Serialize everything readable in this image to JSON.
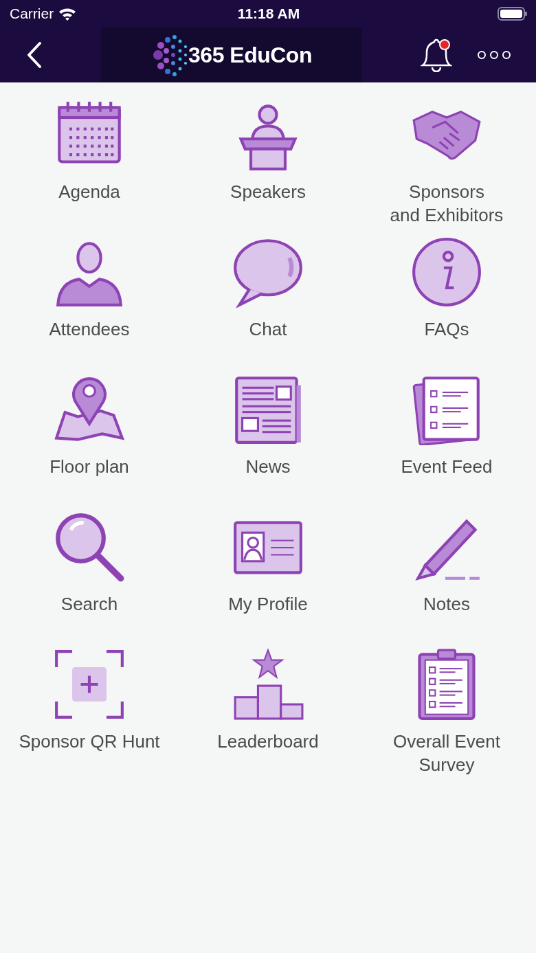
{
  "status_bar": {
    "carrier": "Carrier",
    "time": "11:18 AM"
  },
  "nav_bar": {
    "logo_text": "365 EduCon",
    "notification": true
  },
  "tiles": [
    {
      "label": "Agenda"
    },
    {
      "label": "Speakers"
    },
    {
      "label": "Sponsors\nand Exhibitors"
    },
    {
      "label": "Attendees"
    },
    {
      "label": "Chat"
    },
    {
      "label": "FAQs"
    },
    {
      "label": "Floor plan"
    },
    {
      "label": "News"
    },
    {
      "label": "Event Feed"
    },
    {
      "label": "Search"
    },
    {
      "label": "My Profile"
    },
    {
      "label": "Notes"
    },
    {
      "label": "Sponsor QR Hunt"
    },
    {
      "label": "Leaderboard"
    },
    {
      "label": "Overall Event\nSurvey"
    }
  ]
}
